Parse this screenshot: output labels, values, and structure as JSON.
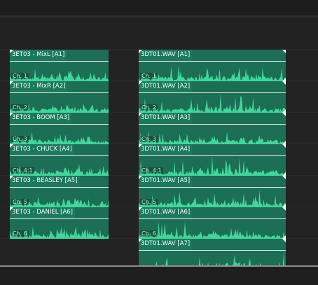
{
  "tracks": [
    {
      "left": {
        "name": "3ET03 - MixL [A1]",
        "channel": "Ch. 1"
      },
      "right": {
        "name": "3DT01.WAV [A1]",
        "channel": "Ch. 1"
      }
    },
    {
      "left": {
        "name": "3ET03 - MixR [A2]",
        "channel": "Ch. 2"
      },
      "right": {
        "name": "3DT01.WAV [A2]",
        "channel": "Ch. 2"
      }
    },
    {
      "left": {
        "name": "3ET03 - BOOM [A3]",
        "channel": "Ch. 3"
      },
      "right": {
        "name": "3DT01.WAV [A3]",
        "channel": "Ch. 3"
      }
    },
    {
      "left": {
        "name": "3ET03 - CHUCK [A4]",
        "channel": "Ch. 4:1"
      },
      "right": {
        "name": "3DT01.WAV [A4]",
        "channel": "Ch. 4:1"
      }
    },
    {
      "left": {
        "name": "3ET03 - BEASLEY [A5]",
        "channel": "Ch. 5"
      },
      "right": {
        "name": "3DT01.WAV [A5]",
        "channel": "Ch. 5"
      }
    },
    {
      "left": {
        "name": "3ET03 - DANIEL [A6]",
        "channel": "Ch. 6"
      },
      "right": {
        "name": "3DT01.WAV [A6]",
        "channel": "Ch. 6"
      }
    },
    {
      "left": null,
      "right": {
        "name": "3DT01.WAV [A7]",
        "channel": ""
      }
    }
  ],
  "colors": {
    "clip_body": "#1c6e54",
    "clip_header": "#1b7a5c",
    "waveform": "#3fd79a",
    "background": "#232323"
  }
}
